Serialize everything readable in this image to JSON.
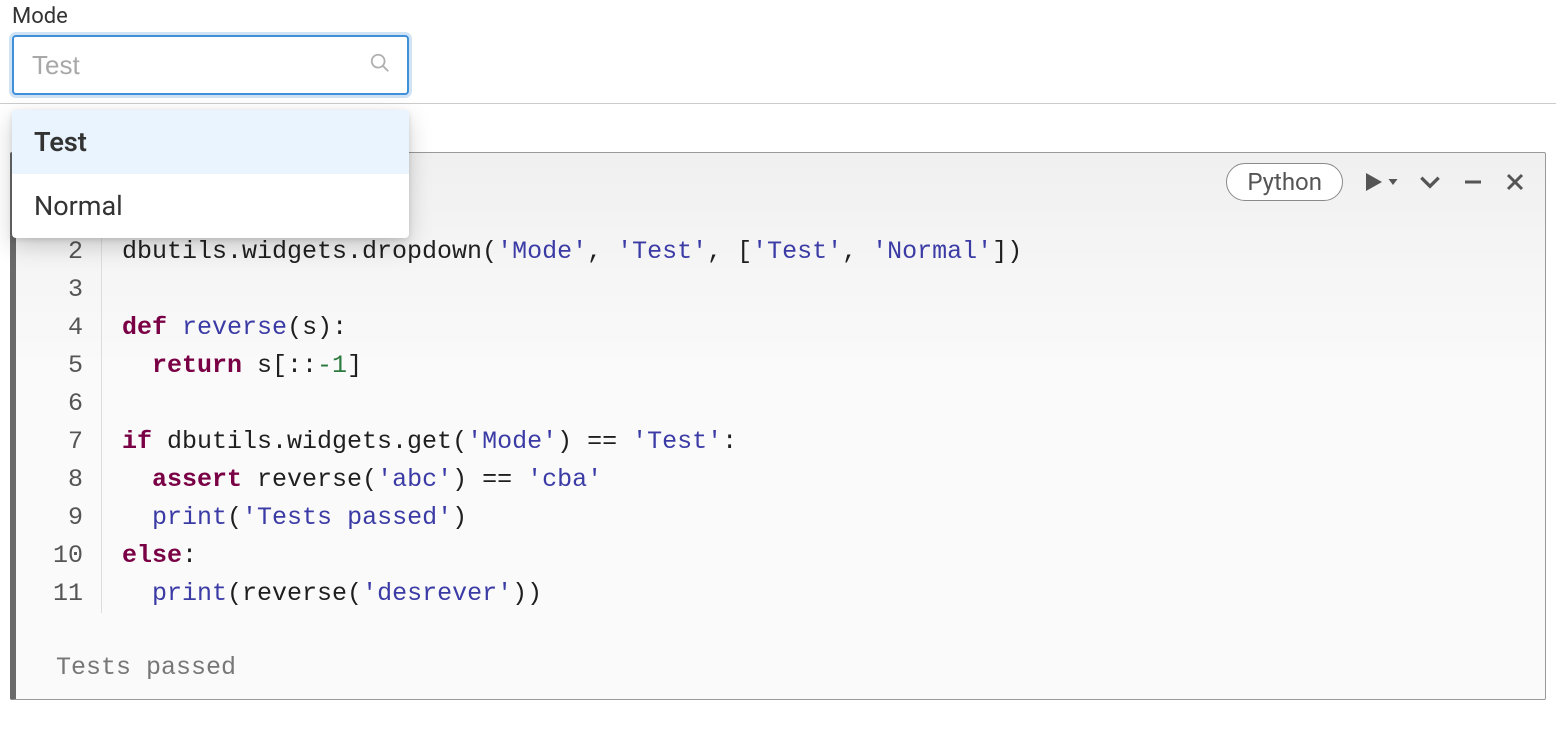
{
  "widget": {
    "label": "Mode",
    "placeholder": "Test",
    "options": [
      "Test",
      "Normal"
    ],
    "selected": "Test"
  },
  "cell": {
    "language": "Python",
    "lines": [
      "2",
      "3",
      "4",
      "5",
      "6",
      "7",
      "8",
      "9",
      "10",
      "11"
    ],
    "code": {
      "l2": {
        "p1": "dbutils.widgets.dropdown(",
        "s1": "'Mode'",
        "c1": ", ",
        "s2": "'Test'",
        "c2": ", [",
        "s3": "'Test'",
        "c3": ", ",
        "s4": "'Normal'",
        "p2": "])"
      },
      "l4": {
        "kw": "def",
        "sp": " ",
        "fn": "reverse",
        "rest": "(s):"
      },
      "l5": {
        "indent": "  ",
        "kw": "return",
        "rest": " s[::",
        "num": "-1",
        "close": "]"
      },
      "l7": {
        "kw": "if",
        "rest": " dbutils.widgets.get(",
        "s1": "'Mode'",
        "mid": ") == ",
        "s2": "'Test'",
        "close": ":"
      },
      "l8": {
        "indent": "  ",
        "kw": "assert",
        "rest": " reverse(",
        "s1": "'abc'",
        "mid": ") == ",
        "s2": "'cba'"
      },
      "l9": {
        "indent": "  ",
        "fn": "print",
        "open": "(",
        "s1": "'Tests passed'",
        "close": ")"
      },
      "l10": {
        "kw": "else",
        "rest": ":"
      },
      "l11": {
        "indent": "  ",
        "fn": "print",
        "open": "(reverse(",
        "s1": "'desrever'",
        "close": "))"
      }
    },
    "output": "Tests passed"
  },
  "icons": {
    "run": "run",
    "expand": "expand",
    "minimize": "minimize",
    "close": "close"
  }
}
